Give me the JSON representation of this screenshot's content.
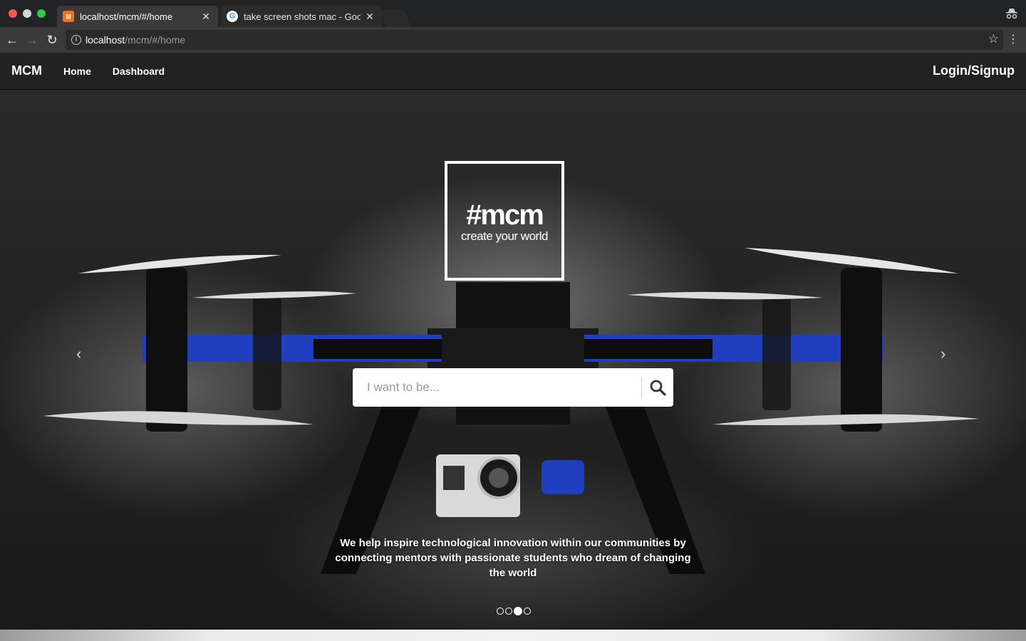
{
  "browser": {
    "tabs": [
      {
        "title": "localhost/mcm/#/home",
        "favicon": "xampp-icon",
        "active": true
      },
      {
        "title": "take screen shots mac - Googl",
        "favicon": "google-icon",
        "active": false
      }
    ],
    "url_host": "localhost",
    "url_path": "/mcm/#/home"
  },
  "navbar": {
    "brand": "MCM",
    "links": [
      "Home",
      "Dashboard"
    ],
    "login": "Login/Signup"
  },
  "hero": {
    "logo_main": "#mcm",
    "logo_tagline": "create your world",
    "search_placeholder": "I want to be...",
    "caption": "We help inspire technological innovation within our communities by connecting mentors with passionate students who dream of changing the world",
    "carousel_slide_count": 4,
    "carousel_active_index": 2
  },
  "colors": {
    "navbar_bg": "#222222",
    "drone_arm": "#1f3fbf",
    "traffic_red": "#fc5753",
    "traffic_green": "#33c748"
  }
}
